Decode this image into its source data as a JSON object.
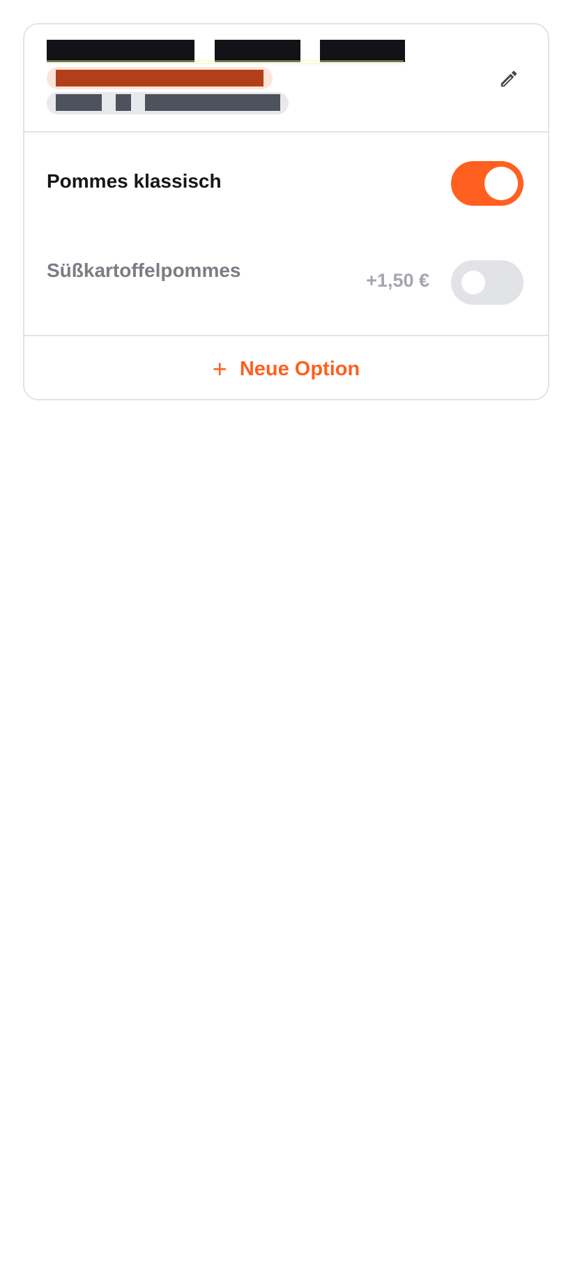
{
  "colors": {
    "accent": "#ff5f1f",
    "text_primary": "#15161a",
    "text_muted": "#7b7d84",
    "border": "#e2e3e6"
  },
  "group": {
    "edit_icon": "pencil-icon"
  },
  "options": [
    {
      "label": "Pommes klassisch",
      "price": "",
      "enabled": true
    },
    {
      "label": "Süßkartoffelpommes",
      "price": "+1,50 €",
      "enabled": false
    }
  ],
  "add_option": {
    "icon": "plus-icon",
    "label": "Neue Option"
  }
}
